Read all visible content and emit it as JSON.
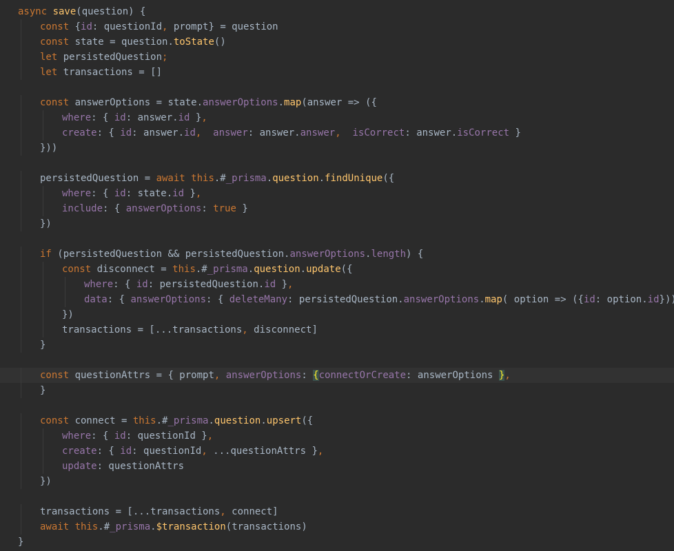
{
  "colors": {
    "background": "#2b2b2b",
    "current_line": "#323232",
    "keyword": "#cc7832",
    "function": "#ffc66d",
    "property": "#9876aa",
    "default": "#a9b7c6",
    "brace_match_bg": "#3b514d",
    "brace_match_fg": "#ffef28"
  },
  "code": {
    "lines": [
      {
        "indent": 0,
        "tokens": [
          [
            "async ",
            "kw"
          ],
          [
            "save",
            "fn"
          ],
          [
            "(question) {",
            "d"
          ]
        ]
      },
      {
        "indent": 1,
        "tokens": [
          [
            "const ",
            "kw"
          ],
          [
            "{",
            "d"
          ],
          [
            "id",
            "prop"
          ],
          [
            ": questionId",
            "d"
          ],
          [
            ", ",
            "kw"
          ],
          [
            "prompt} = question",
            "d"
          ]
        ]
      },
      {
        "indent": 1,
        "tokens": [
          [
            "const ",
            "kw"
          ],
          [
            "state = question.",
            "d"
          ],
          [
            "toState",
            "fn"
          ],
          [
            "()",
            "d"
          ]
        ]
      },
      {
        "indent": 1,
        "tokens": [
          [
            "let ",
            "kw"
          ],
          [
            "persistedQuestion",
            "d"
          ],
          [
            ";",
            "kw"
          ]
        ]
      },
      {
        "indent": 1,
        "tokens": [
          [
            "let ",
            "kw"
          ],
          [
            "transactions = []",
            "d"
          ]
        ]
      },
      {
        "indent": 0,
        "tokens": []
      },
      {
        "indent": 1,
        "tokens": [
          [
            "const ",
            "kw"
          ],
          [
            "answerOptions = state.",
            "d"
          ],
          [
            "answerOptions",
            "prop"
          ],
          [
            ".",
            "d"
          ],
          [
            "map",
            "fn"
          ],
          [
            "(answer => ({",
            "d"
          ]
        ]
      },
      {
        "indent": 2,
        "tokens": [
          [
            "where",
            "prop"
          ],
          [
            ": { ",
            "d"
          ],
          [
            "id",
            "prop"
          ],
          [
            ": answer.",
            "d"
          ],
          [
            "id",
            "prop"
          ],
          [
            " }",
            "d"
          ],
          [
            ",",
            "kw"
          ]
        ]
      },
      {
        "indent": 2,
        "tokens": [
          [
            "create",
            "prop"
          ],
          [
            ": { ",
            "d"
          ],
          [
            "id",
            "prop"
          ],
          [
            ": answer.",
            "d"
          ],
          [
            "id",
            "prop"
          ],
          [
            ",  ",
            "kw"
          ],
          [
            "answer",
            "prop"
          ],
          [
            ": answer.",
            "d"
          ],
          [
            "answer",
            "prop"
          ],
          [
            ",  ",
            "kw"
          ],
          [
            "isCorrect",
            "prop"
          ],
          [
            ": answer.",
            "d"
          ],
          [
            "isCorrect",
            "prop"
          ],
          [
            " }",
            "d"
          ]
        ]
      },
      {
        "indent": 1,
        "tokens": [
          [
            "}))",
            "d"
          ]
        ]
      },
      {
        "indent": 0,
        "tokens": []
      },
      {
        "indent": 1,
        "tokens": [
          [
            "persistedQuestion = ",
            "d"
          ],
          [
            "await ",
            "kw"
          ],
          [
            "this",
            "kw"
          ],
          [
            ".#",
            "d"
          ],
          [
            "_prisma",
            "prop"
          ],
          [
            ".",
            "d"
          ],
          [
            "question",
            "fn"
          ],
          [
            ".",
            "d"
          ],
          [
            "findUnique",
            "fn"
          ],
          [
            "({",
            "d"
          ]
        ]
      },
      {
        "indent": 2,
        "tokens": [
          [
            "where",
            "prop"
          ],
          [
            ": { ",
            "d"
          ],
          [
            "id",
            "prop"
          ],
          [
            ": state.",
            "d"
          ],
          [
            "id",
            "prop"
          ],
          [
            " }",
            "d"
          ],
          [
            ",",
            "kw"
          ]
        ]
      },
      {
        "indent": 2,
        "tokens": [
          [
            "include",
            "prop"
          ],
          [
            ": { ",
            "d"
          ],
          [
            "answerOptions",
            "prop"
          ],
          [
            ": ",
            "d"
          ],
          [
            "true",
            "kw"
          ],
          [
            " }",
            "d"
          ]
        ]
      },
      {
        "indent": 1,
        "tokens": [
          [
            "})",
            "d"
          ]
        ]
      },
      {
        "indent": 0,
        "tokens": []
      },
      {
        "indent": 1,
        "tokens": [
          [
            "if ",
            "kw"
          ],
          [
            "(persistedQuestion && persistedQuestion.",
            "d"
          ],
          [
            "answerOptions",
            "prop"
          ],
          [
            ".",
            "d"
          ],
          [
            "length",
            "prop"
          ],
          [
            ") {",
            "d"
          ]
        ]
      },
      {
        "indent": 2,
        "tokens": [
          [
            "const ",
            "kw"
          ],
          [
            "disconnect = ",
            "d"
          ],
          [
            "this",
            "kw"
          ],
          [
            ".#",
            "d"
          ],
          [
            "_prisma",
            "prop"
          ],
          [
            ".",
            "d"
          ],
          [
            "question",
            "fn"
          ],
          [
            ".",
            "d"
          ],
          [
            "update",
            "fn"
          ],
          [
            "({",
            "d"
          ]
        ]
      },
      {
        "indent": 3,
        "tokens": [
          [
            "where",
            "prop"
          ],
          [
            ": { ",
            "d"
          ],
          [
            "id",
            "prop"
          ],
          [
            ": persistedQuestion.",
            "d"
          ],
          [
            "id",
            "prop"
          ],
          [
            " }",
            "d"
          ],
          [
            ",",
            "kw"
          ]
        ]
      },
      {
        "indent": 3,
        "tokens": [
          [
            "data",
            "prop"
          ],
          [
            ": { ",
            "d"
          ],
          [
            "answerOptions",
            "prop"
          ],
          [
            ": { ",
            "d"
          ],
          [
            "deleteMany",
            "prop"
          ],
          [
            ": persistedQuestion.",
            "d"
          ],
          [
            "answerOptions",
            "prop"
          ],
          [
            ".",
            "d"
          ],
          [
            "map",
            "fn"
          ],
          [
            "( option => ({",
            "d"
          ],
          [
            "id",
            "prop"
          ],
          [
            ": option.",
            "d"
          ],
          [
            "id",
            "prop"
          ],
          [
            "})) } }",
            "d"
          ]
        ]
      },
      {
        "indent": 2,
        "tokens": [
          [
            "})",
            "d"
          ]
        ]
      },
      {
        "indent": 2,
        "tokens": [
          [
            "transactions = [...transactions",
            "d"
          ],
          [
            ", ",
            "kw"
          ],
          [
            "disconnect]",
            "d"
          ]
        ]
      },
      {
        "indent": 1,
        "tokens": [
          [
            "}",
            "d"
          ]
        ]
      },
      {
        "indent": 0,
        "tokens": []
      },
      {
        "indent": 1,
        "current": true,
        "tokens": [
          [
            "const ",
            "kw"
          ],
          [
            "questionAttrs = { prompt",
            "d"
          ],
          [
            ", ",
            "kw"
          ],
          [
            "answerOptions",
            "prop"
          ],
          [
            ": ",
            "d"
          ],
          [
            "{",
            "bm"
          ],
          [
            "connectOrCreate",
            "prop"
          ],
          [
            ": answerOptions ",
            "d"
          ],
          [
            "}",
            "bm"
          ],
          [
            ",",
            "kw"
          ]
        ]
      },
      {
        "indent": 1,
        "tokens": [
          [
            "}",
            "d"
          ]
        ]
      },
      {
        "indent": 0,
        "tokens": []
      },
      {
        "indent": 1,
        "tokens": [
          [
            "const ",
            "kw"
          ],
          [
            "connect = ",
            "d"
          ],
          [
            "this",
            "kw"
          ],
          [
            ".#",
            "d"
          ],
          [
            "_prisma",
            "prop"
          ],
          [
            ".",
            "d"
          ],
          [
            "question",
            "fn"
          ],
          [
            ".",
            "d"
          ],
          [
            "upsert",
            "fn"
          ],
          [
            "({",
            "d"
          ]
        ]
      },
      {
        "indent": 2,
        "tokens": [
          [
            "where",
            "prop"
          ],
          [
            ": { ",
            "d"
          ],
          [
            "id",
            "prop"
          ],
          [
            ": questionId }",
            "d"
          ],
          [
            ",",
            "kw"
          ]
        ]
      },
      {
        "indent": 2,
        "tokens": [
          [
            "create",
            "prop"
          ],
          [
            ": { ",
            "d"
          ],
          [
            "id",
            "prop"
          ],
          [
            ": questionId",
            "d"
          ],
          [
            ", ",
            "kw"
          ],
          [
            "...questionAttrs }",
            "d"
          ],
          [
            ",",
            "kw"
          ]
        ]
      },
      {
        "indent": 2,
        "tokens": [
          [
            "update",
            "prop"
          ],
          [
            ": questionAttrs",
            "d"
          ]
        ]
      },
      {
        "indent": 1,
        "tokens": [
          [
            "})",
            "d"
          ]
        ]
      },
      {
        "indent": 0,
        "tokens": []
      },
      {
        "indent": 1,
        "tokens": [
          [
            "transactions = [...transactions",
            "d"
          ],
          [
            ", ",
            "kw"
          ],
          [
            "connect]",
            "d"
          ]
        ]
      },
      {
        "indent": 1,
        "tokens": [
          [
            "await ",
            "kw"
          ],
          [
            "this",
            "kw"
          ],
          [
            ".#",
            "d"
          ],
          [
            "_prisma",
            "prop"
          ],
          [
            ".",
            "d"
          ],
          [
            "$transaction",
            "fn"
          ],
          [
            "(transactions)",
            "d"
          ]
        ]
      },
      {
        "indent": 0,
        "tokens": [
          [
            "}",
            "d"
          ]
        ]
      }
    ]
  }
}
